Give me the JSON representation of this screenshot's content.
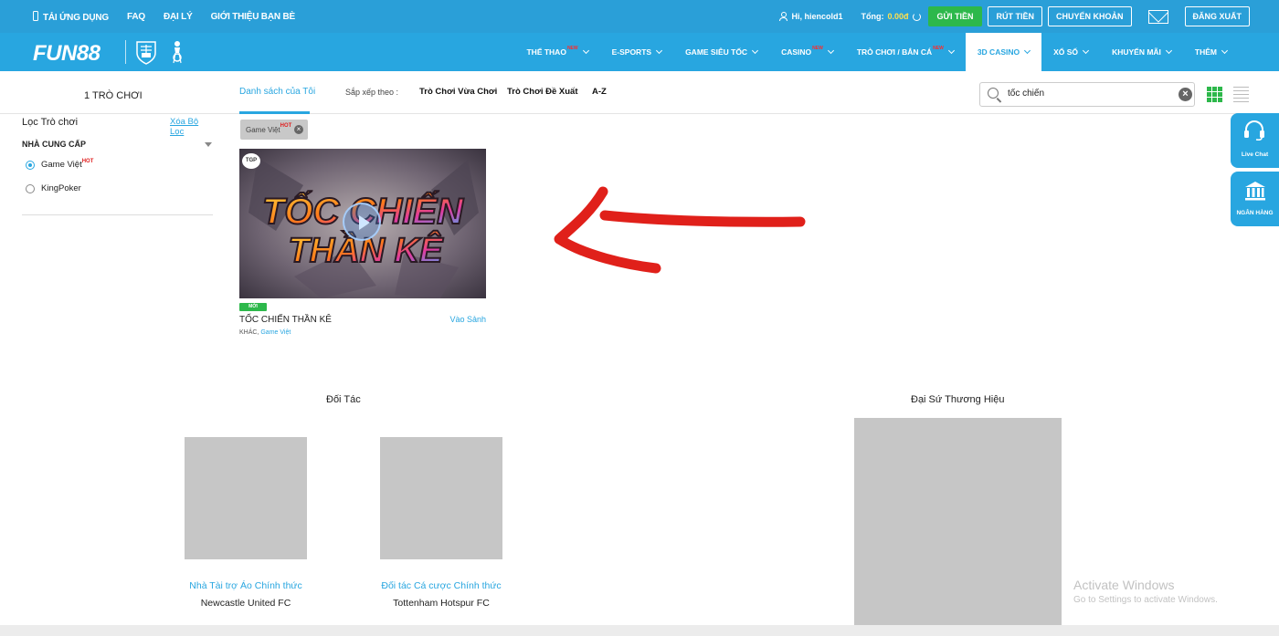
{
  "topbar": {
    "links": [
      "TẢI ỨNG DỤNG",
      "FAQ",
      "ĐẠI LÝ",
      "GIỚI THIỆU BẠN BÈ"
    ],
    "user_greeting": "Hi, hiencold1",
    "total_label": "Tổng:",
    "total_amount": "0.00đ",
    "deposit_label": "GỬI TIỀN",
    "withdraw_label": "RÚT TIỀN",
    "transfer_label": "CHUYỂN KHOẢN",
    "logout_label": "ĐĂNG XUẤT"
  },
  "brand": {
    "logo_text": "FUN88"
  },
  "nav": {
    "items": [
      {
        "label": "THỂ THAO",
        "badge": "NEW"
      },
      {
        "label": "E-SPORTS",
        "badge": ""
      },
      {
        "label": "GAME SIÊU TỐC",
        "badge": ""
      },
      {
        "label": "CASINO",
        "badge": "NEW"
      },
      {
        "label": "TRÒ CHƠI / BẮN CÁ",
        "badge": "NEW"
      },
      {
        "label": "3D CASINO",
        "badge": ""
      },
      {
        "label": "XỔ SỐ",
        "badge": ""
      },
      {
        "label": "KHUYẾN MÃI",
        "badge": ""
      },
      {
        "label": "THÊM",
        "badge": ""
      }
    ],
    "active_index": 5
  },
  "filterbar": {
    "game_count": "1 TRÒ CHƠI",
    "tab_mine": "Danh sách của Tôi",
    "sort_label": "Sắp xếp theo :",
    "sort_options": [
      "Trò Chơi Vừa Chơi",
      "Trò Chơi Đề Xuất",
      "A-Z"
    ],
    "search_value": "tốc chiến"
  },
  "sidebar": {
    "title": "Lọc Trò chơi",
    "clear_label": "Xóa Bộ Lọc",
    "provider_heading": "NHÀ CUNG CẤP",
    "providers": [
      {
        "label": "Game Việt",
        "badge": "HOT",
        "selected": true
      },
      {
        "label": "KingPoker",
        "badge": "",
        "selected": false
      }
    ]
  },
  "active_filter": {
    "label": "Game Việt",
    "badge": "HOT"
  },
  "game_card": {
    "provider_tag": "TGP",
    "new_badge": "MỚI",
    "title": "TỐC CHIẾN THẦN KÊ",
    "enter_label": "Vào Sảnh",
    "category": "KHÁC,",
    "provider": "Game Việt",
    "art_text_line1": "TỐC CHIẾN",
    "art_text_line2": "THẦN KÊ"
  },
  "partners": {
    "title": "Đối Tác",
    "items": [
      {
        "caption": "Nhà Tài trợ Áo Chính thức",
        "name": "Newcastle United FC"
      },
      {
        "caption": "Đối tác Cá cược Chính thức",
        "name": "Tottenham Hotspur FC"
      }
    ]
  },
  "ambassador": {
    "title": "Đại Sứ Thương Hiệu"
  },
  "side_widgets": {
    "live_chat": "Live Chat",
    "bank": "NGÂN HÀNG"
  },
  "watermark": {
    "line1": "Activate Windows",
    "line2": "Go to Settings to activate Windows."
  },
  "colors": {
    "brand_blue": "#28a6e0",
    "green": "#2db84b",
    "hot_red": "#e02020",
    "annotation_red": "#e0201a"
  }
}
